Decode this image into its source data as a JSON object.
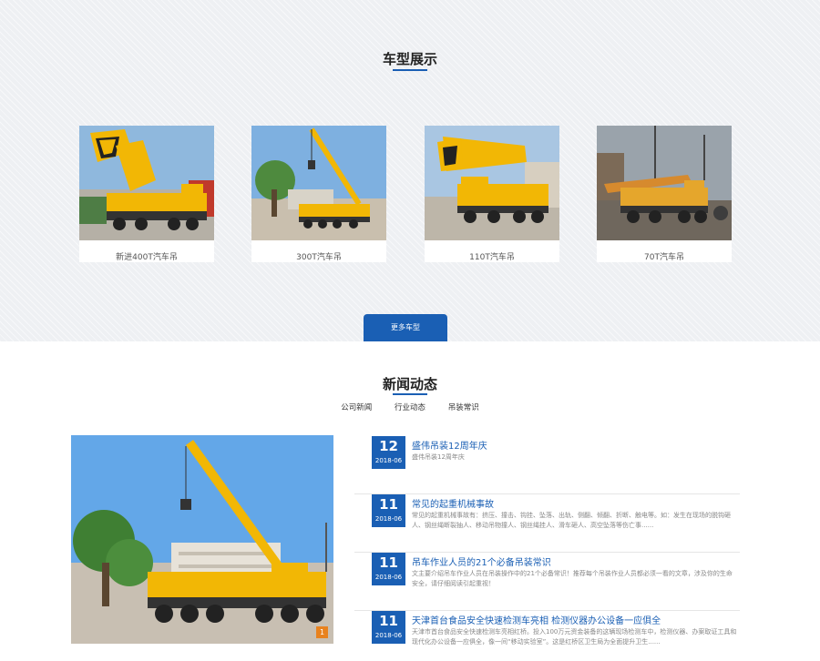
{
  "models_section": {
    "title": "车型展示",
    "items": [
      {
        "caption": "新进400T汽车吊"
      },
      {
        "caption": "300T汽车吊"
      },
      {
        "caption": "110T汽车吊"
      },
      {
        "caption": "70T汽车吊"
      }
    ],
    "more_label": "更多车型"
  },
  "news_section": {
    "title": "新闻动态",
    "tabs": [
      "公司新闻",
      "行业动态",
      "吊装常识"
    ],
    "feature_badge": "1",
    "items": [
      {
        "day": "12",
        "ym": "2018-06",
        "title": "盛伟吊装12周年庆",
        "desc": "盛伟吊装12周年庆"
      },
      {
        "day": "11",
        "ym": "2018-06",
        "title": "常见的起重机械事故",
        "desc": "常见的起重机械事故有：挤压、撞击、钩挂、坠落、出轨、侧翻、倾翻、折断、触电等。如：发生在现场的脱钩砸人、钢丝绳断裂抽人、移动吊物撞人、钢丝绳挂人、滑车砸人、高空坠落等伤亡事......"
      },
      {
        "day": "11",
        "ym": "2018-06",
        "title": "吊车作业人员的21个必备吊装常识",
        "desc": "文主要介绍吊车作业人员在吊装操作中的21个必备常识！推荐每个吊装作业人员都必须一看的文章，涉及你的生命安全，请仔细阅读引起重视！"
      },
      {
        "day": "11",
        "ym": "2018-06",
        "title": "天津首台食品安全快速检测车亮相 检测仪器办公设备一应俱全",
        "desc": "天津市首台食品安全快速检测车亮相红桥。投入100万元资金装备的这辆现场检测车中，检测仪器、办案取证工具和现代化办公设备一应俱全，像一间“移动实验室”。这是红桥区卫生局为全面提升卫生......"
      }
    ]
  },
  "colors": {
    "accent": "#1a5fb4",
    "badge": "#e8821e",
    "crane_yellow": "#f2b705"
  }
}
